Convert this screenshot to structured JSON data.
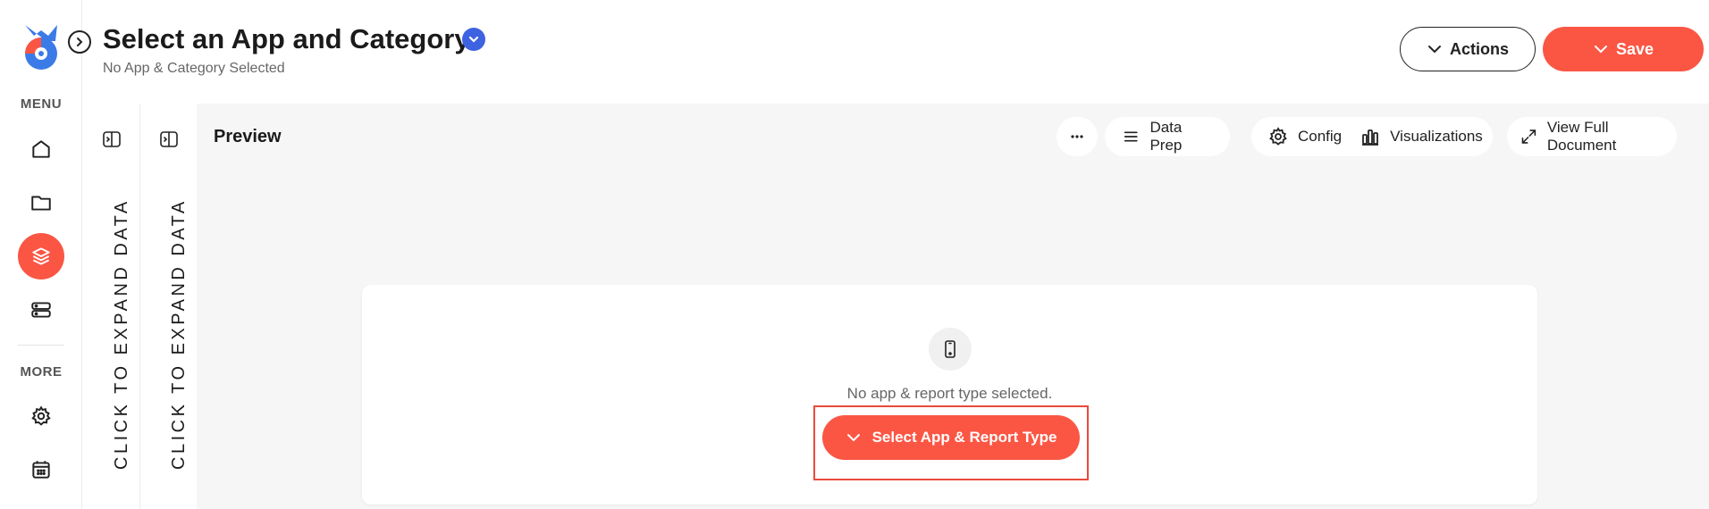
{
  "nav": {
    "menu_label": "MENU",
    "more_label": "MORE",
    "items": [
      "home-icon",
      "folder-icon",
      "layers-icon",
      "servers-icon"
    ],
    "more_items": [
      "gear-icon",
      "calendar-icon"
    ],
    "active_item": "layers-icon",
    "accent_color": "#fb5644"
  },
  "header": {
    "title": "Select an App and Category",
    "subtitle": "No App & Category Selected",
    "actions_label": "Actions",
    "save_label": "Save"
  },
  "panels": [
    {
      "label": "CLICK TO EXPAND DATA"
    },
    {
      "label": "CLICK TO EXPAND DATA"
    }
  ],
  "preview": {
    "label": "Preview",
    "more_icon": "ellipsis-icon",
    "data_prep_label": "Data Prep",
    "config_label": "Config",
    "visualizations_label": "Visualizations",
    "view_full_label": "View Full Document"
  },
  "empty_state": {
    "icon": "mobile-icon",
    "message": "No app & report type selected.",
    "button_label": "Select App & Report Type"
  }
}
